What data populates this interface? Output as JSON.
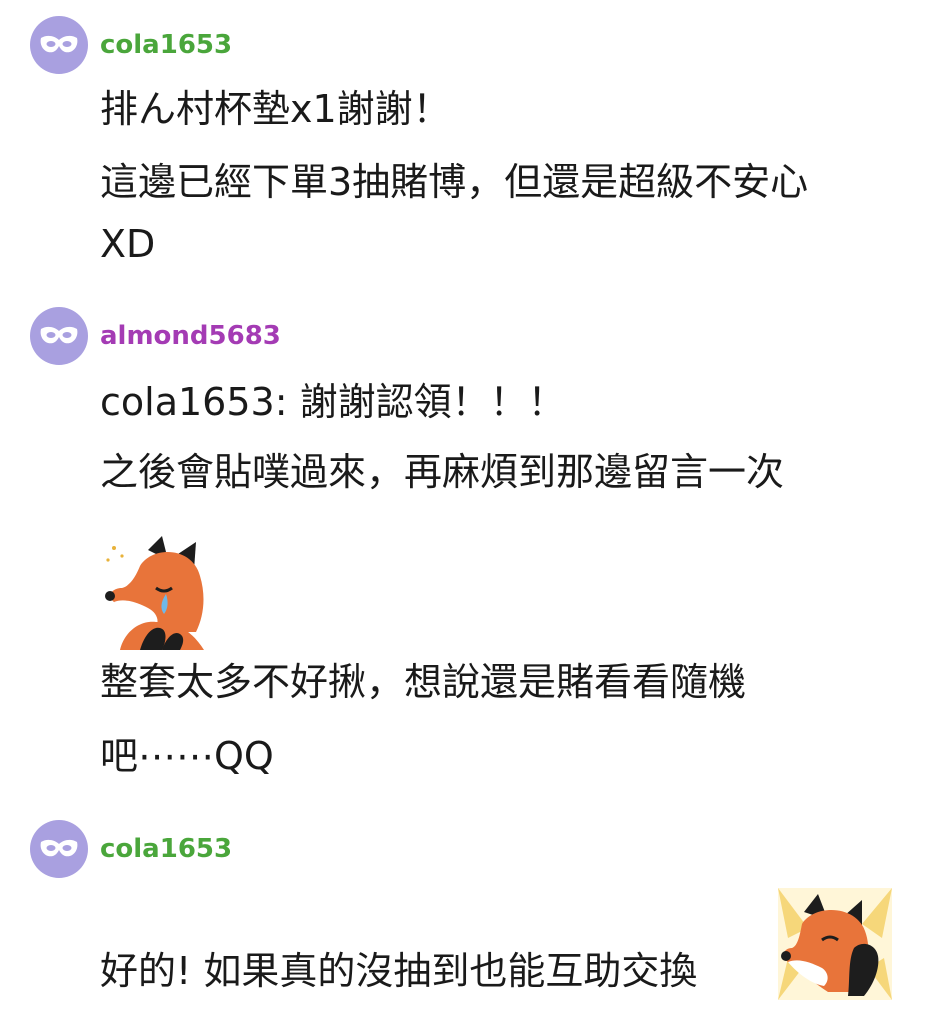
{
  "comments": [
    {
      "username": "cola1653",
      "username_color": "#4aa63b",
      "lines": [
        "排ん村杯墊x1謝謝！",
        "這邊已經下單3抽賭博，但還是超級不安心",
        "XD"
      ]
    },
    {
      "username": "almond5683",
      "username_color": "#a43bb4",
      "lines": [
        "cola1653: 謝謝認領！！！",
        "之後會貼噗過來，再麻煩到那邊留言一次"
      ],
      "sticker": "crying-fox-sticker",
      "lines_after": [
        "整套太多不好揪，想說還是賭看看隨機",
        "吧⋯⋯QQ"
      ]
    },
    {
      "username": "cola1653",
      "username_color": "#4aa63b",
      "lines": [
        "好的! 如果真的沒抽到也能互助交換"
      ],
      "sticker": "happy-fox-sticker"
    }
  ],
  "avatar_icon": "mask-icon",
  "avatar_color": "#a9a0e0"
}
